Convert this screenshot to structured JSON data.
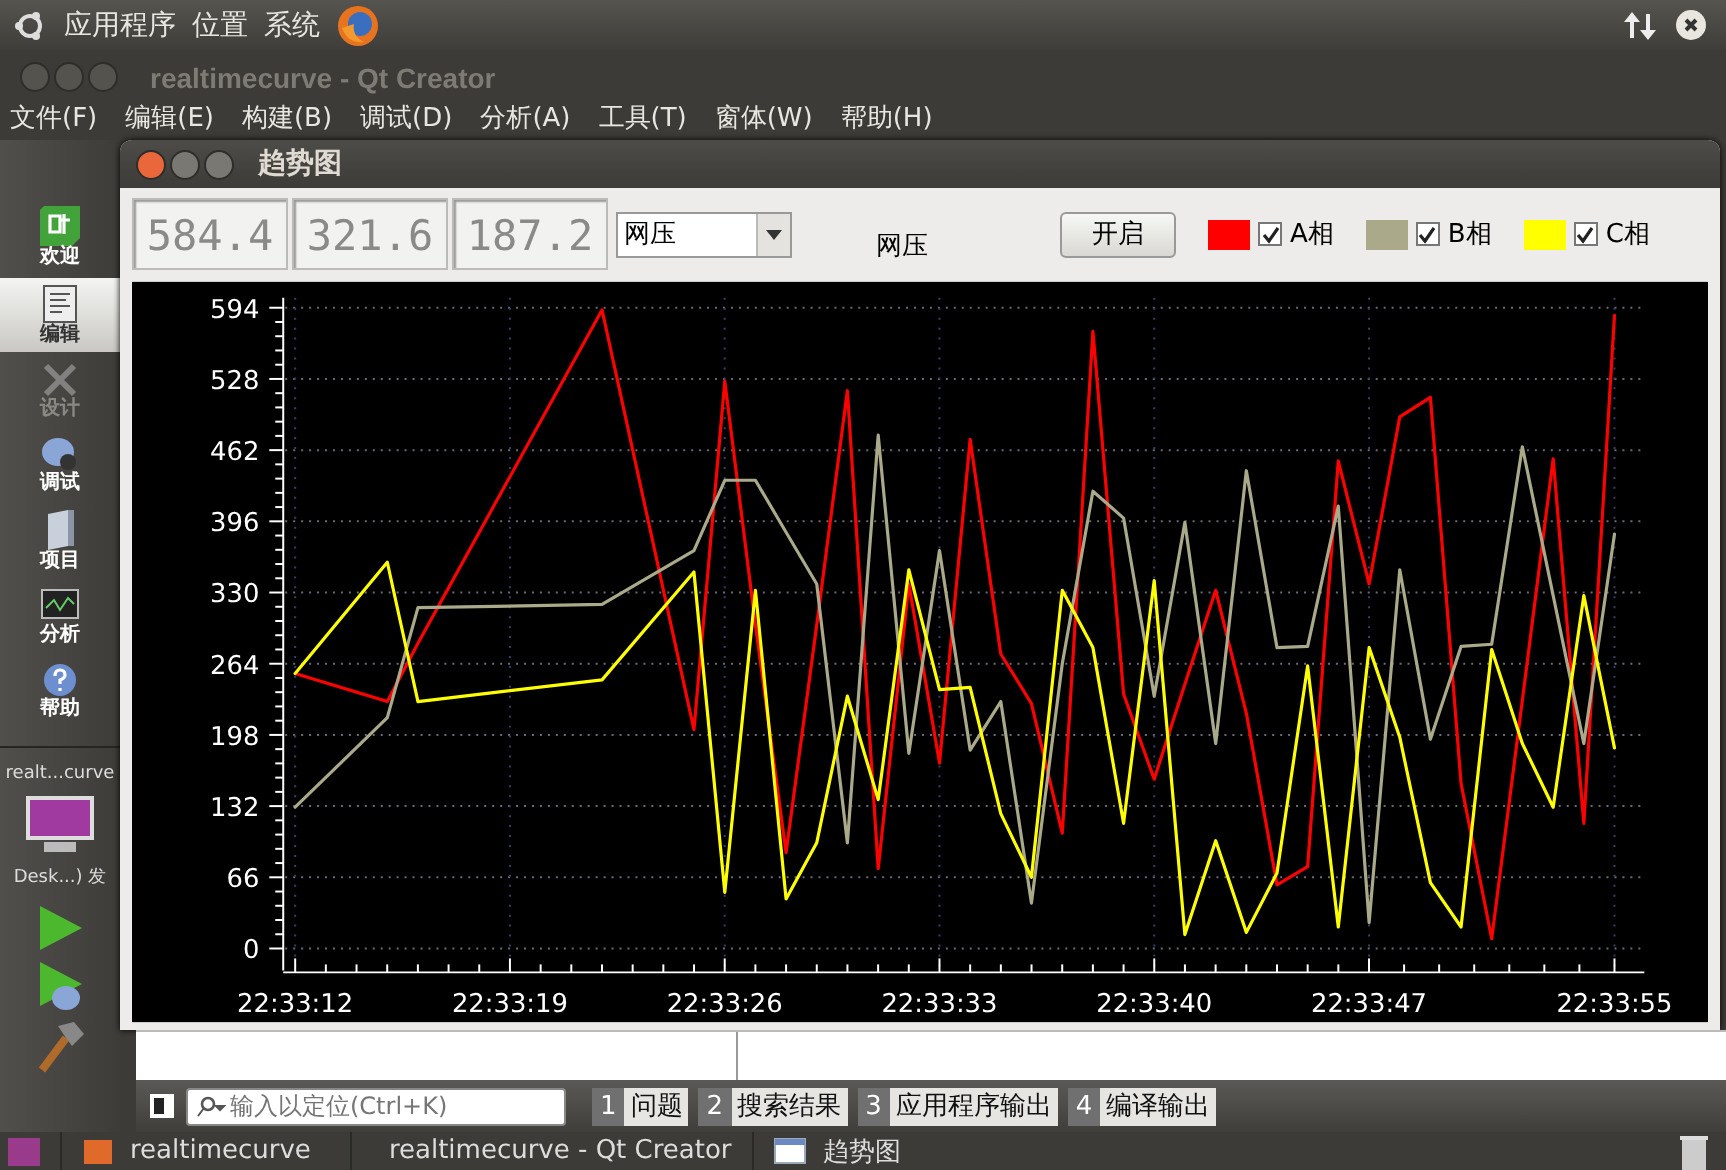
{
  "top_panel": {
    "menus": [
      "应用程序",
      "位置",
      "系统"
    ]
  },
  "ide_window": {
    "title": "realtimecurve - Qt Creator"
  },
  "menu_bar": {
    "items": [
      "文件(F)",
      "编辑(E)",
      "构建(B)",
      "调试(D)",
      "分析(A)",
      "工具(T)",
      "窗体(W)",
      "帮助(H)"
    ]
  },
  "mode_bar": {
    "modes": [
      {
        "kind": "qt",
        "label": "欢迎",
        "selected": false,
        "disabled": false
      },
      {
        "kind": "edit",
        "label": "编辑",
        "selected": true,
        "disabled": false
      },
      {
        "kind": "design",
        "label": "设计",
        "selected": false,
        "disabled": true
      },
      {
        "kind": "debug",
        "label": "调试",
        "selected": false,
        "disabled": false
      },
      {
        "kind": "project",
        "label": "项目",
        "selected": false,
        "disabled": false
      },
      {
        "kind": "analyze",
        "label": "分析",
        "selected": false,
        "disabled": false
      },
      {
        "kind": "help",
        "label": "帮助",
        "selected": false,
        "disabled": false
      }
    ],
    "project": "realt...curve",
    "target": "Desk...) 发"
  },
  "dialog": {
    "title": "趋势图",
    "readouts": [
      "584.4",
      "321.6",
      "187.2"
    ],
    "combo": {
      "value": "网压"
    },
    "label": "网压",
    "start_button": "开启",
    "legend": [
      {
        "checked": true
      },
      {
        "checked": true
      },
      {
        "checked": true
      }
    ],
    "chart_data": {
      "type": "line",
      "x": [
        81192,
        81195,
        81196,
        81202,
        81205,
        81206,
        81207,
        81208,
        81209,
        81210,
        81211,
        81212,
        81213,
        81214,
        81215,
        81216,
        81217,
        81218,
        81219,
        81220,
        81221,
        81222,
        81223,
        81224,
        81225,
        81226,
        81227,
        81228,
        81229,
        81230,
        81231,
        81232,
        81233,
        81234,
        81235
      ],
      "xlim": [
        81192,
        81235
      ],
      "ylim": [
        0,
        594
      ],
      "grid": true,
      "xticks": [
        {
          "value": 81192,
          "label": "22:33:12"
        },
        {
          "value": 81199,
          "label": "22:33:19"
        },
        {
          "value": 81206,
          "label": "22:33:26"
        },
        {
          "value": 81213,
          "label": "22:33:33"
        },
        {
          "value": 81220,
          "label": "22:33:40"
        },
        {
          "value": 81227,
          "label": "22:33:47"
        },
        {
          "value": 81235,
          "label": "22:33:55"
        }
      ],
      "yticks": [
        0,
        66,
        132,
        198,
        264,
        330,
        396,
        462,
        528,
        594
      ],
      "series": [
        {
          "name": "A相",
          "color": "#ff0000",
          "values": [
            255,
            229,
            283,
            592,
            203,
            526,
            300,
            89,
            300,
            517,
            74,
            338,
            172,
            472,
            273,
            227,
            107,
            572,
            236,
            157,
            245,
            332,
            218,
            59,
            76,
            452,
            338,
            493,
            511,
            153,
            9,
            230,
            454,
            116,
            587
          ]
        },
        {
          "name": "B相",
          "color": "#aaa98a",
          "values": [
            131,
            214,
            316,
            319,
            369,
            434,
            434,
            386,
            338,
            98,
            476,
            181,
            369,
            184,
            229,
            42,
            264,
            424,
            399,
            234,
            395,
            190,
            443,
            279,
            280,
            410,
            24,
            351,
            194,
            280,
            282,
            465,
            327,
            190,
            384
          ]
        },
        {
          "name": "C相",
          "color": "#ffff00",
          "values": [
            255,
            358,
            229,
            249,
            349,
            52,
            332,
            46,
            98,
            234,
            138,
            351,
            240,
            242,
            125,
            66,
            332,
            279,
            116,
            341,
            13,
            100,
            15,
            70,
            262,
            20,
            279,
            196,
            61,
            20,
            277,
            190,
            131,
            327,
            186
          ]
        }
      ]
    }
  },
  "output_pane": {
    "search": {
      "placeholder": "输入以定位(Ctrl+K)"
    },
    "tabs": [
      {
        "number": "1",
        "label": "问题"
      },
      {
        "number": "2",
        "label": "搜索结果"
      },
      {
        "number": "3",
        "label": "应用程序输出"
      },
      {
        "number": "4",
        "label": "编译输出"
      }
    ]
  },
  "taskbar": {
    "items": [
      {
        "kind": "folder",
        "label": "realtimecurve"
      },
      {
        "kind": "qt",
        "label": "realtimecurve - Qt Creator"
      },
      {
        "kind": "window",
        "label": "趋势图"
      }
    ]
  }
}
